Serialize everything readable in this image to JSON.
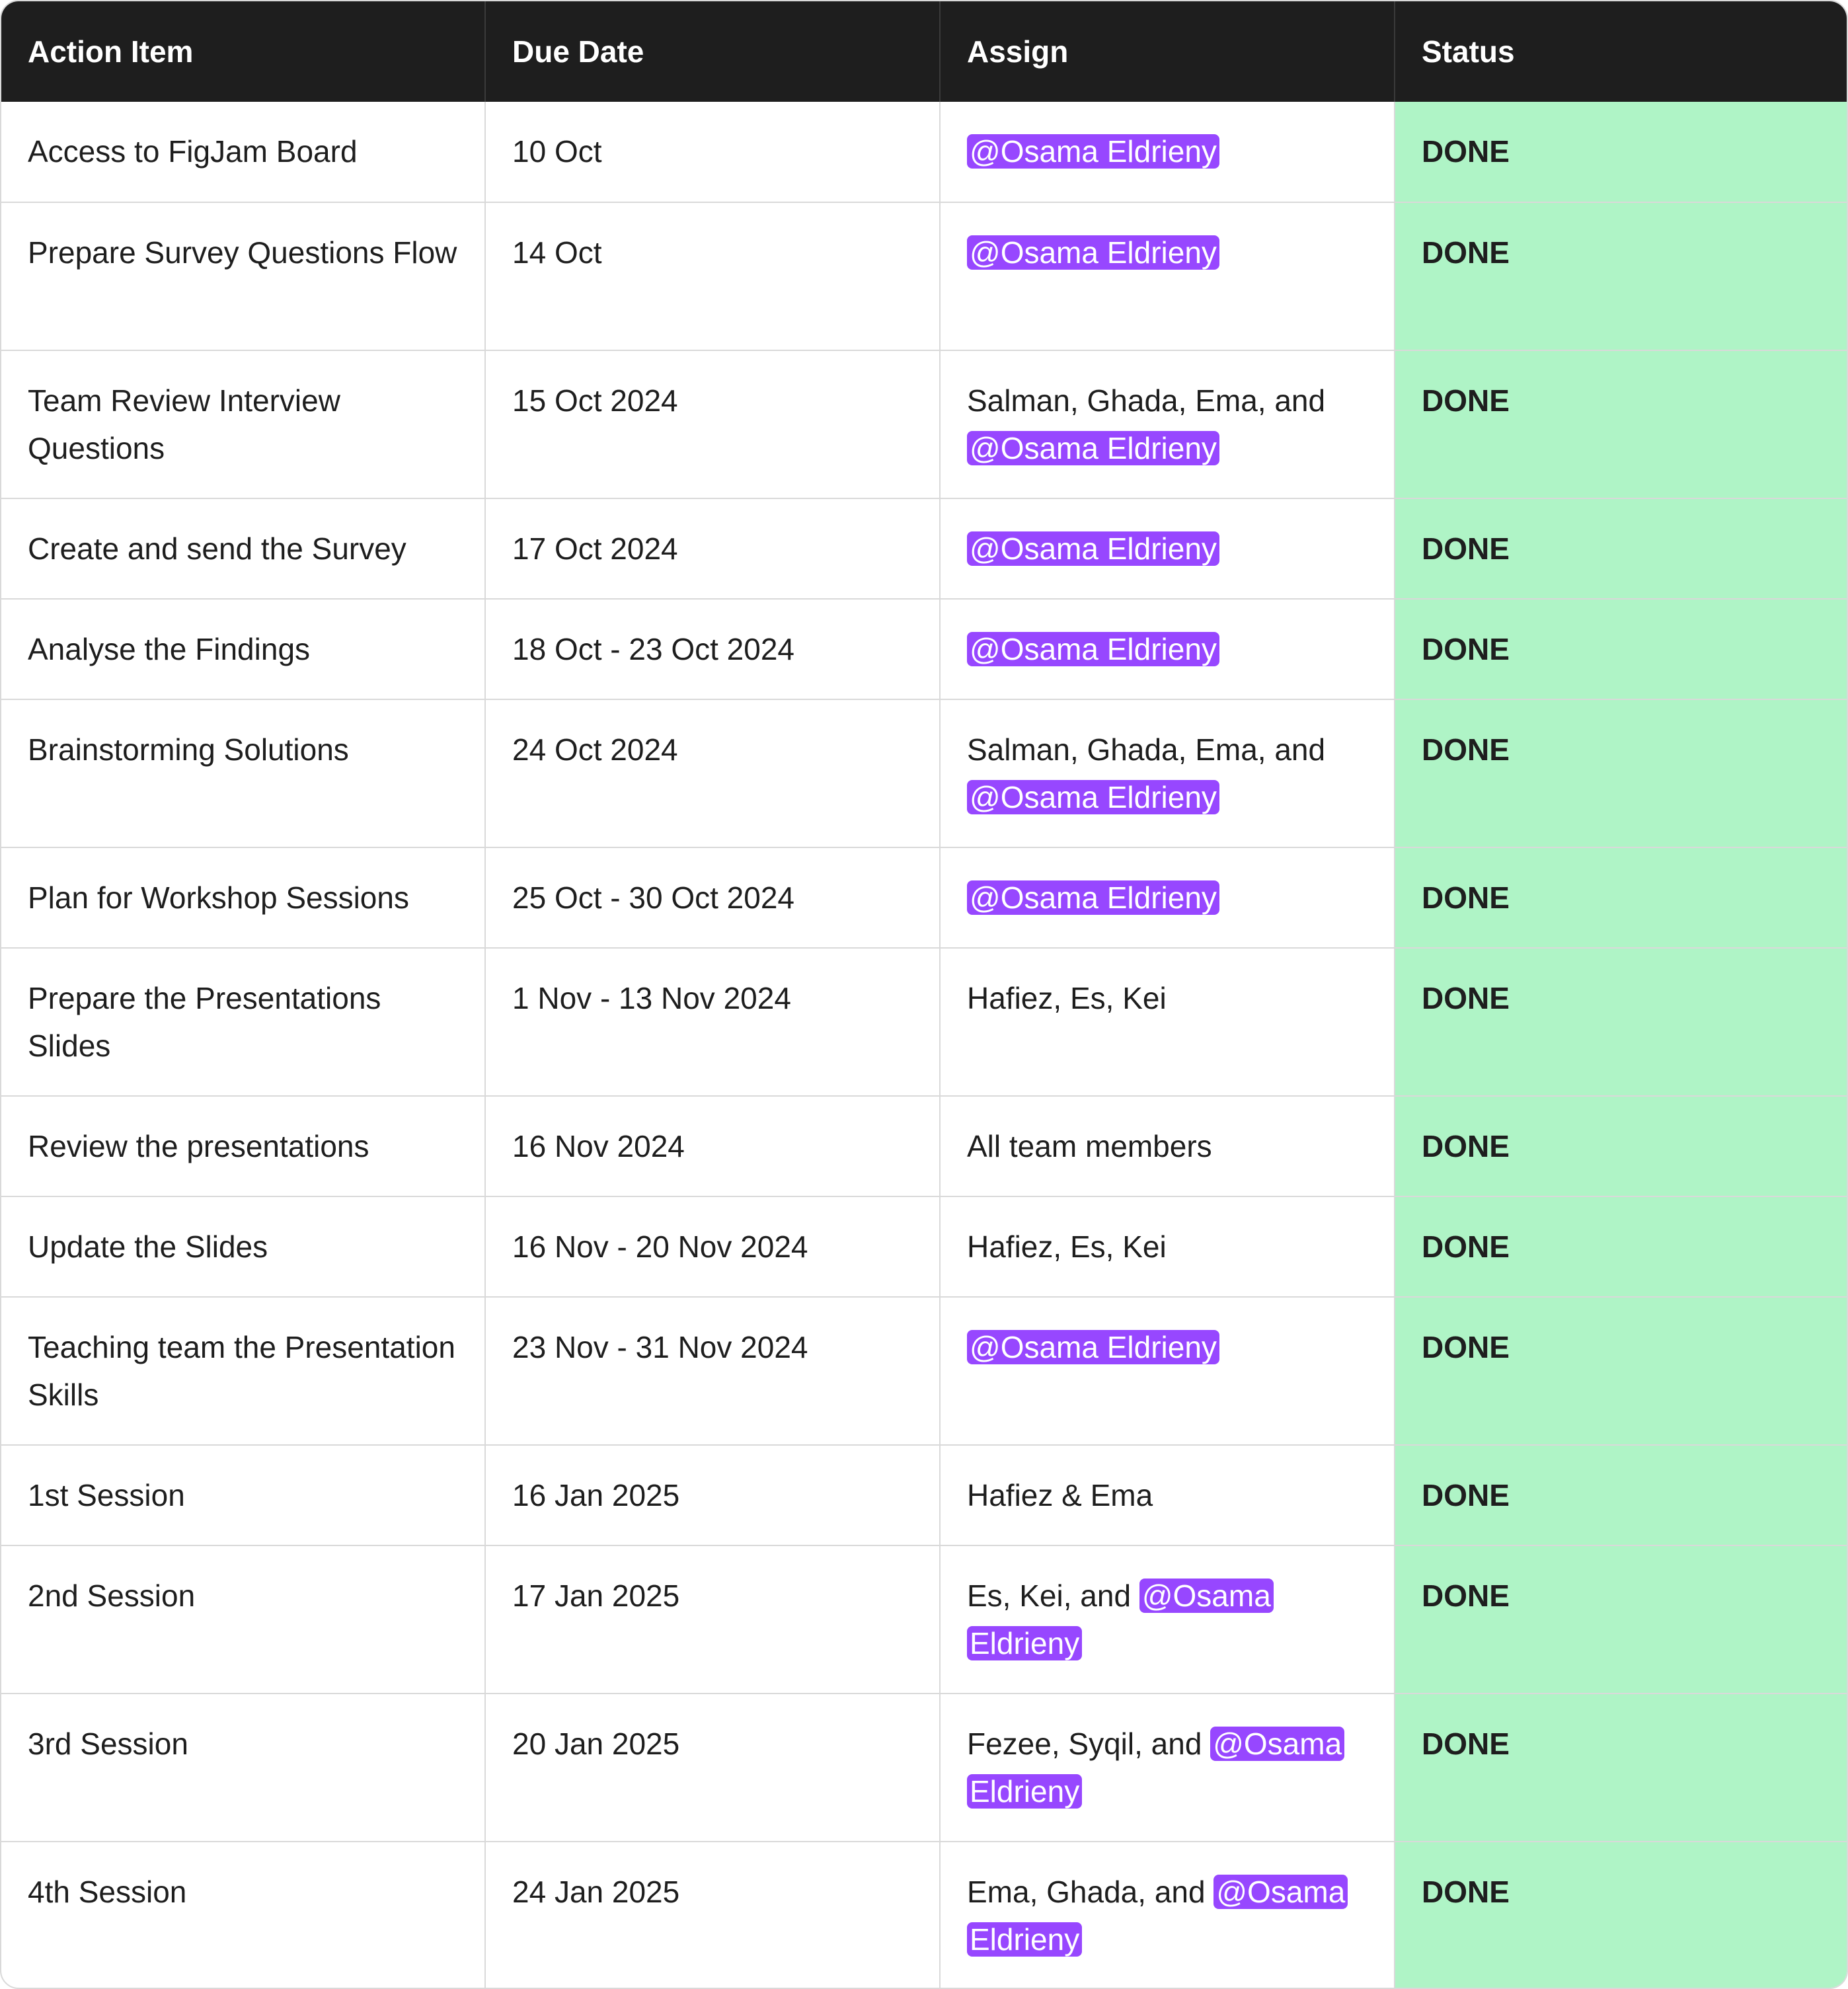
{
  "headers": [
    "Action Item",
    "Due Date",
    "Assign",
    "Status"
  ],
  "colors": {
    "header_bg": "#1e1e1e",
    "status_bg": "#aff4c6",
    "mention_bg": "#9747ff"
  },
  "rows": [
    {
      "item": "Access to FigJam Board",
      "due": "10 Oct",
      "assign_text": "",
      "assign_mention": "@Osama Eldrieny",
      "status": "DONE"
    },
    {
      "item": "Prepare Survey Questions Flow",
      "due": "14 Oct",
      "assign_text": "",
      "assign_mention": "@Osama Eldrieny",
      "status": "DONE"
    },
    {
      "item": "Team Review Interview Questions",
      "due": "15 Oct 2024",
      "assign_text": "Salman, Ghada, Ema, and",
      "assign_mention": "@Osama Eldrieny",
      "status": "DONE"
    },
    {
      "item": "Create and send the Survey",
      "due": "17 Oct 2024",
      "assign_text": "",
      "assign_mention": "@Osama Eldrieny",
      "status": "DONE"
    },
    {
      "item": "Analyse the Findings",
      "due": "18 Oct - 23 Oct 2024",
      "assign_text": "",
      "assign_mention": "@Osama Eldrieny",
      "status": "DONE"
    },
    {
      "item": "Brainstorming Solutions",
      "due": "24 Oct 2024",
      "assign_text": "Salman, Ghada, Ema, and",
      "assign_mention": "@Osama Eldrieny",
      "status": "DONE"
    },
    {
      "item": "Plan for Workshop Sessions",
      "due": "25 Oct - 30 Oct 2024",
      "assign_text": "",
      "assign_mention": "@Osama Eldrieny",
      "status": "DONE"
    },
    {
      "item": "Prepare the Presentations Slides",
      "due": "1 Nov - 13 Nov 2024",
      "assign_text": "Hafiez, Es, Kei",
      "assign_mention": "",
      "status": "DONE"
    },
    {
      "item": "Review the presentations",
      "due": "16 Nov 2024",
      "assign_text": "All team members",
      "assign_mention": "",
      "status": "DONE"
    },
    {
      "item": "Update the Slides",
      "due": "16 Nov - 20 Nov 2024",
      "assign_text": "Hafiez, Es, Kei",
      "assign_mention": "",
      "status": "DONE"
    },
    {
      "item": "Teaching team the Presentation Skills",
      "due": "23 Nov - 31 Nov 2024",
      "assign_text": "",
      "assign_mention": "@Osama Eldrieny",
      "status": "DONE"
    },
    {
      "item": "1st Session",
      "due": "16 Jan 2025",
      "assign_text": "Hafiez & Ema",
      "assign_mention": "",
      "status": "DONE"
    },
    {
      "item": "2nd Session",
      "due": "17 Jan 2025",
      "assign_text": "Es, Kei, and",
      "assign_mention": "@Osama Eldrieny",
      "status": "DONE"
    },
    {
      "item": "3rd Session",
      "due": "20 Jan 2025",
      "assign_text": "Fezee, Syqil, and",
      "assign_mention": "@Osama Eldrieny",
      "status": "DONE"
    },
    {
      "item": "4th Session",
      "due": "24 Jan 2025",
      "assign_text": "Ema, Ghada, and",
      "assign_mention": "@Osama Eldrieny",
      "status": "DONE"
    }
  ]
}
